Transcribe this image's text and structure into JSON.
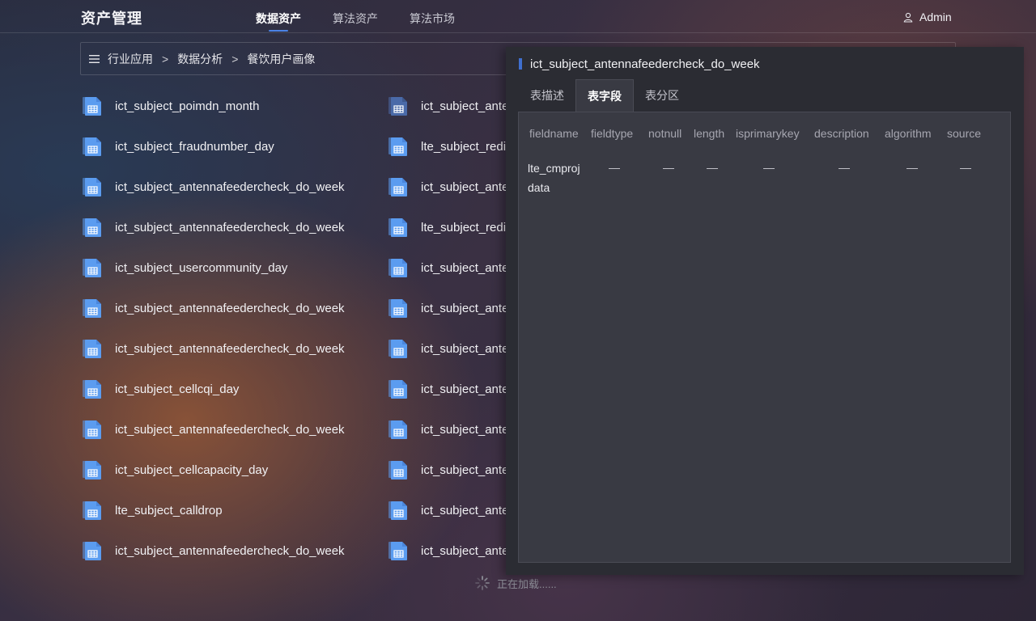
{
  "header": {
    "brand": "资产管理",
    "nav": [
      {
        "label": "数据资产",
        "active": true
      },
      {
        "label": "算法资产",
        "active": false
      },
      {
        "label": "算法市场",
        "active": false
      }
    ],
    "user": {
      "label": "Admin",
      "icon": "user-icon"
    }
  },
  "breadcrumb": {
    "icon": "menu-icon",
    "items": [
      "行业应用",
      "数据分析",
      "餐饮用户画像"
    ],
    "separator": ">"
  },
  "datasets": {
    "left": [
      "ict_subject_poimdn_month",
      "ict_subject_fraudnumber_day",
      "ict_subject_antennafeedercheck_do_week",
      "ict_subject_antennafeedercheck_do_week",
      "ict_subject_usercommunity_day",
      "ict_subject_antennafeedercheck_do_week",
      "ict_subject_antennafeedercheck_do_week",
      "ict_subject_cellcqi_day",
      "ict_subject_antennafeedercheck_do_week",
      "ict_subject_cellcapacity_day",
      "lte_subject_calldrop",
      "ict_subject_antennafeedercheck_do_week"
    ],
    "right": [
      "ict_subject_ante",
      "lte_subject_redi",
      "ict_subject_ante",
      "lte_subject_redi",
      "ict_subject_ante",
      "ict_subject_ante",
      "ict_subject_ante",
      "ict_subject_ante",
      "ict_subject_ante",
      "ict_subject_ante",
      "ict_subject_ante",
      "ict_subject_ante"
    ]
  },
  "loading": {
    "text": "正在加载......"
  },
  "panel": {
    "title": "ict_subject_antennafeedercheck_do_week",
    "tabs": [
      {
        "label": "表描述",
        "active": false
      },
      {
        "label": "表字段",
        "active": true
      },
      {
        "label": "表分区",
        "active": false
      }
    ],
    "columns": [
      "fieldname",
      "fieldtype",
      "notnull",
      "length",
      "isprimarykey",
      "description",
      "algorithm",
      "source"
    ],
    "rows": [
      [
        "lte_cmprojdata",
        "—",
        "—",
        "—",
        "—",
        "—",
        "—",
        "—"
      ]
    ]
  },
  "colors": {
    "accent": "#4b83e6",
    "title_bar": "#3f6fcf",
    "panel_bg": "#2b2c33",
    "tab_body_bg": "#393a43",
    "file_icon": "#5b9cf0"
  }
}
